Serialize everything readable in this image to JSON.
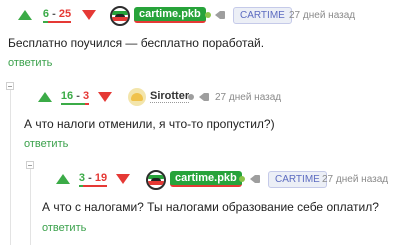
{
  "comments": [
    {
      "score_plus": "6",
      "score_minus": "25",
      "score_sep": " - ",
      "username": "cartime.pkb",
      "group": "CARTIME",
      "time": "27 дней назад",
      "text": "Бесплатно поучился — бесплатно поработай.",
      "reply": "ответить",
      "online_color": "#8bc34a"
    },
    {
      "score_plus": "16",
      "score_minus": "3",
      "score_sep": " - ",
      "username": "Sirotter",
      "time": "27 дней назад",
      "text": "А что налоги отменили, я что-то пропустил?)",
      "reply": "ответить",
      "online_color": "#9e9e9e"
    },
    {
      "score_plus": "3",
      "score_minus": "19",
      "score_sep": " - ",
      "username": "cartime.pkb",
      "group": "CARTIME",
      "time": "27 дней назад",
      "text": "А что с налогами? Ты налогами образование себе оплатил?",
      "reply": "ответить",
      "online_color": "#8bc34a"
    }
  ],
  "colors": {
    "upvote": "#3bab47",
    "downvote": "#e53935",
    "link": "#3aa14b",
    "badge_text": "#5c6bc0"
  }
}
